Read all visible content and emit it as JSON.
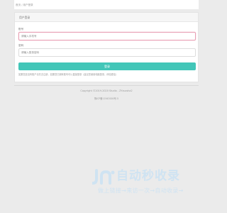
{
  "breadcrumb": {
    "home": "首页",
    "separator": "/",
    "current": "用户登录"
  },
  "panel": {
    "title": "用户登录"
  },
  "form": {
    "phone_label": "账号",
    "phone_placeholder": "请输入手机号",
    "password_label": "密码",
    "password_placeholder": "请输入登录密码",
    "submit_label": "登录",
    "note": "如果您还没有账户请先去注册，如果您已拥有账号可以直接登录（建议您使用电脑登录，体验更佳）"
  },
  "footer": {
    "copyright": "Copyright ©2019-2020 Studio - ZYzuosha2",
    "icp": "豫ICP备11943000号-5"
  },
  "watermark": {
    "title": "自动秒收录",
    "slogan": "做上链接→来访一次→自动收录→"
  },
  "colors": {
    "accent": "#42c6b8",
    "active_border": "#e8a0b4",
    "watermark": "#cfe3f2"
  }
}
